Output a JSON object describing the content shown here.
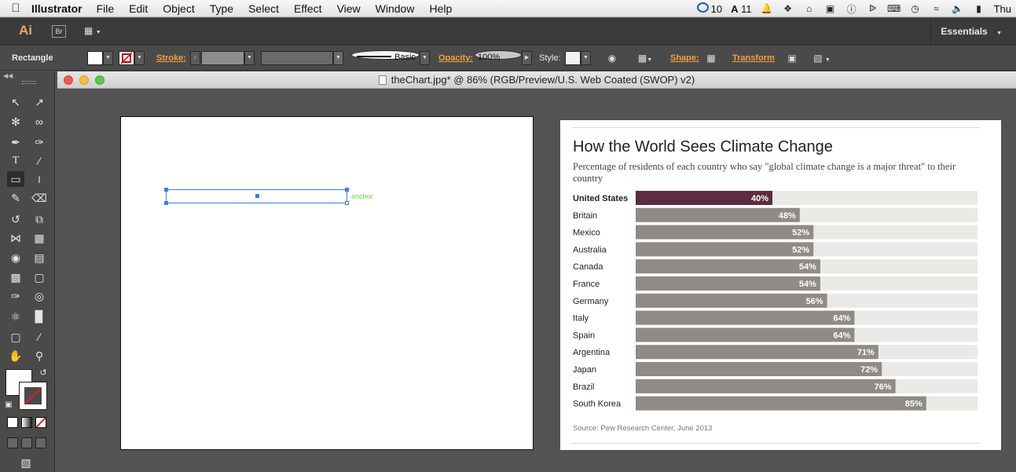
{
  "menubar": {
    "app_name": "Illustrator",
    "menus": [
      "File",
      "Edit",
      "Object",
      "Type",
      "Select",
      "Effect",
      "View",
      "Window",
      "Help"
    ],
    "cc_count": "10",
    "adobe_count": "11",
    "day": "Thu"
  },
  "appbar": {
    "logo": "Ai",
    "bridge": "Br",
    "workspace": "Essentials"
  },
  "control": {
    "tool_name": "Rectangle",
    "stroke_label": "Stroke:",
    "brush_value": "Basic",
    "opacity_label": "Opacity:",
    "opacity_value": "100%",
    "style_label": "Style:",
    "shape_label": "Shape:",
    "transform_label": "Transform"
  },
  "document": {
    "title": "theChart.jpg* @ 86% (RGB/Preview/U.S. Web Coated (SWOP) v2)",
    "anchor_label": "anchor"
  },
  "colors": {
    "highlight_bar": "#5e2b3e",
    "bar": "#8f8b85",
    "track": "#eae9e5",
    "anchor": "#6bd44b",
    "selection": "#3a7ce8"
  },
  "chart_data": {
    "type": "bar",
    "title": "How the World Sees Climate Change",
    "subtitle": "Percentage of residents of each country who say \"global climate change is a major threat\" to their country",
    "source": "Source: Pew Research Center, June 2013",
    "categories": [
      "United States",
      "Britain",
      "Mexico",
      "Australia",
      "Canada",
      "France",
      "Germany",
      "Italy",
      "Spain",
      "Argentina",
      "Japan",
      "Brazil",
      "South Korea"
    ],
    "values": [
      40,
      48,
      52,
      52,
      54,
      54,
      56,
      64,
      64,
      71,
      72,
      76,
      85
    ],
    "labels": [
      "40%",
      "48%",
      "52%",
      "52%",
      "54%",
      "54%",
      "56%",
      "64%",
      "64%",
      "71%",
      "72%",
      "76%",
      "85%"
    ],
    "highlight": "United States",
    "xlim": [
      0,
      100
    ]
  }
}
